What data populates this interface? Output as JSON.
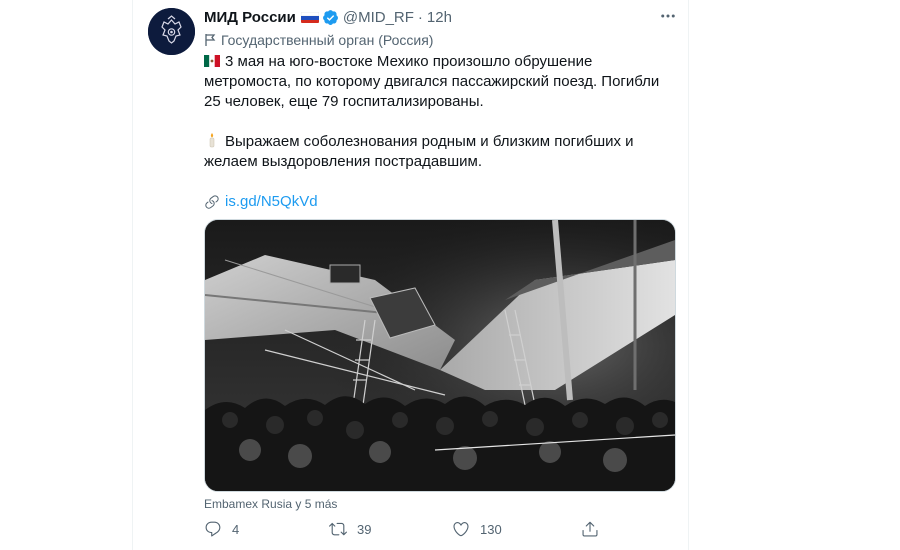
{
  "tweet": {
    "author_name": "МИД России",
    "handle": "@MID_RF",
    "separator": "·",
    "time": "12h",
    "more_icon": "more-horizontal-icon",
    "label": "Государственный орган (Россия)",
    "paragraphs": [
      "3 мая на юго-востоке Мехико произошло обрушение метромоста, по которому двигался пассажирский поезд. Погибли 25 человек, еще 79 госпитализированы.",
      "Выражаем соболезнования родным и близким погибших и желаем выздоровления пострадавшим."
    ],
    "link_text": "is.gd/N5QkVd",
    "media_caption": "Embamex Rusia y 5 más",
    "actions": {
      "reply_count": "4",
      "retweet_count": "39",
      "like_count": "130"
    }
  },
  "colors": {
    "link": "#1d9bf0",
    "secondary_text": "#536471",
    "verified": "#1d9bf0"
  }
}
